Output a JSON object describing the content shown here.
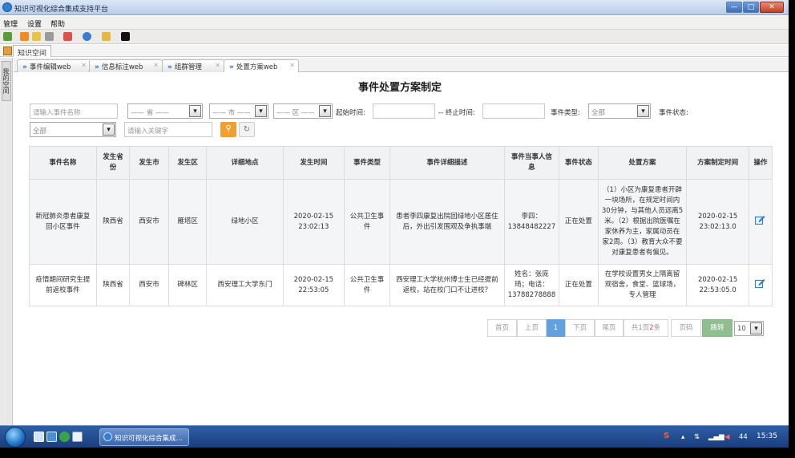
{
  "window": {
    "title": "知识可视化综合集成支持平台"
  },
  "menu": [
    "管理",
    "设置",
    "帮助"
  ],
  "space": {
    "tab_label": "知识空间"
  },
  "vertical_tab": "我的空间",
  "tabs": [
    "事件编辑web",
    "信息标注web",
    "组群管理",
    "处置方案web"
  ],
  "page": {
    "title": "事件处置方案制定"
  },
  "filters": {
    "event_name_placeholder": "请输入事件名称",
    "province": "—— 省 ——",
    "city": "—— 市 ——",
    "district": "—— 区 ——",
    "start_time_label": "起始时间:",
    "end_time_label": "-- 终止时间:",
    "event_type_label": "事件类型:",
    "event_type_value": "全部",
    "event_status_label": "事件状态:",
    "event_status_value": "全部",
    "keyword_placeholder": "请输入关键字"
  },
  "table": {
    "headers": [
      "事件名称",
      "发生省份",
      "发生市",
      "发生区",
      "详细地点",
      "发生时间",
      "事件类型",
      "事件详细描述",
      "事件当事人信息",
      "事件状态",
      "处置方案",
      "方案制定时间",
      "操作"
    ],
    "rows": [
      [
        "新冠肺炎患者康复回小区事件",
        "陕西省",
        "西安市",
        "雁塔区",
        "绿地小区",
        "2020-02-15 23:02:13",
        "公共卫生事件",
        "患者李四康复出院回绿地小区居住后，外出引发围观及争执事端",
        "李四：13848482227",
        "正在处置",
        "（1）小区为康复患者开辟一块场所，在规定时间内30分钟，与其他人员远离5米。（2）根据出院医嘱在家休养为主，家属动员在家2周。（3）教育大众不要对康复患者有偏见。",
        "2020-02-15 23:02:13.0"
      ],
      [
        "疫情期间研究生提前返校事件",
        "陕西省",
        "西安市",
        "碑林区",
        "西安理工大学东门",
        "2020-02-15 22:53:05",
        "公共卫生事件",
        "西安理工大学杭州博士生已经提前返校，站在校门口不让进校？",
        "姓名：张庞琦；电话：13788278888",
        "正在处置",
        "在学校设置男女上隔离留观宿舍，食堂、篮球场，专人管理",
        "2020-02-15 22:53:05.0"
      ]
    ]
  },
  "pagination": {
    "first": "首页",
    "prev": "上页",
    "current": "1",
    "next": "下页",
    "last": "尾页",
    "summary_prefix": "共1页",
    "summary_count": "2",
    "summary_suffix": "条",
    "page_input": "页码",
    "go": "跳转",
    "page_size": "10"
  },
  "taskbar": {
    "task_label": "知识可视化综合集成...",
    "tray_num": "44",
    "time": "15:35"
  },
  "colors": {
    "accent": "#5fa2dd",
    "search_button": "#f0a030",
    "go_button": "#8fbf8f"
  }
}
